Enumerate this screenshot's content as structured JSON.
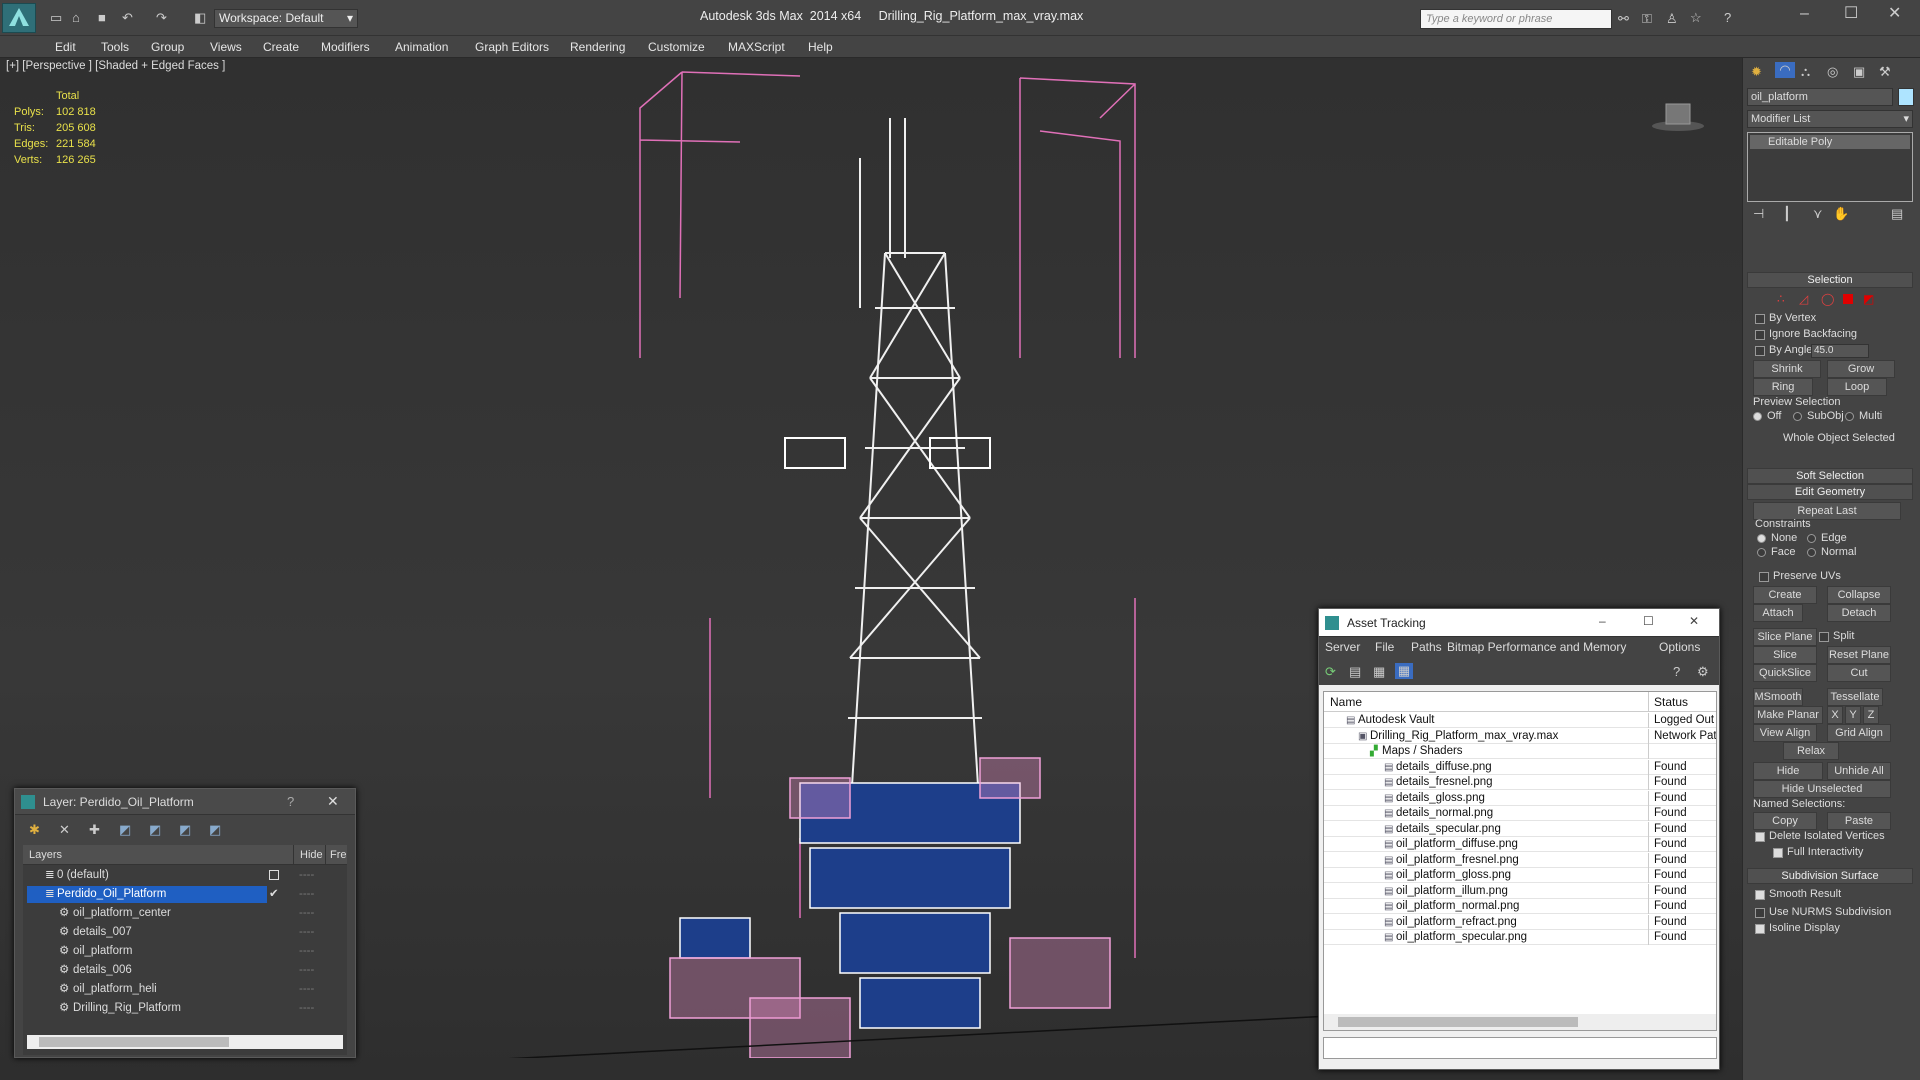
{
  "titlebar": {
    "title": "Autodesk 3ds Max  2014 x64     Drilling_Rig_Platform_max_vray.max",
    "workspace": "Workspace: Default",
    "search_placeholder": "Type a keyword or phrase"
  },
  "menu": [
    "Edit",
    "Tools",
    "Group",
    "Views",
    "Create",
    "Modifiers",
    "Animation",
    "Graph Editors",
    "Rendering",
    "Customize",
    "MAXScript",
    "Help"
  ],
  "viewport": {
    "label": "[+] [Perspective ] [Shaded + Edged Faces ]",
    "stats": {
      "header": "Total",
      "rows": [
        {
          "k": "Polys:",
          "v": "102 818"
        },
        {
          "k": "Tris:",
          "v": "205 608"
        },
        {
          "k": "Edges:",
          "v": "221 584"
        },
        {
          "k": "Verts:",
          "v": "126 265"
        }
      ]
    }
  },
  "command_panel": {
    "object_name": "oil_platform",
    "modifier_list": "Modifier List",
    "stack": [
      "Editable Poly"
    ],
    "selection": {
      "header": "Selection",
      "by_vertex": "By Vertex",
      "ignore_backfacing": "Ignore Backfacing",
      "by_angle": "By Angle:",
      "angle": "45.0",
      "shrink": "Shrink",
      "grow": "Grow",
      "ring": "Ring",
      "loop": "Loop",
      "preview": "Preview Selection",
      "off": "Off",
      "subobj": "SubObj",
      "multi": "Multi",
      "status": "Whole Object Selected"
    },
    "soft_selection": "Soft Selection",
    "edit_geometry": "Edit Geometry",
    "repeat_last": "Repeat Last",
    "constraints": "Constraints",
    "none": "None",
    "edge": "Edge",
    "face": "Face",
    "normal": "Normal",
    "preserve_uvs": "Preserve UVs",
    "create": "Create",
    "collapse": "Collapse",
    "attach": "Attach",
    "detach": "Detach",
    "slice_plane": "Slice Plane",
    "split": "Split",
    "slice": "Slice",
    "reset_plane": "Reset Plane",
    "quickslice": "QuickSlice",
    "cut": "Cut",
    "msmooth": "MSmooth",
    "tessellate": "Tessellate",
    "make_planar": "Make Planar",
    "x": "X",
    "y": "Y",
    "z": "Z",
    "view_align": "View Align",
    "grid_align": "Grid Align",
    "relax": "Relax",
    "hide_selected": "Hide Selected",
    "unhide_all": "Unhide All",
    "hide_unselected": "Hide Unselected",
    "named_selections": "Named Selections:",
    "copy": "Copy",
    "paste": "Paste",
    "delete_isolated": "Delete Isolated Vertices",
    "full_interactivity": "Full Interactivity",
    "subdivision_surface": "Subdivision Surface",
    "smooth_result": "Smooth Result",
    "use_nurms": "Use NURMS Subdivision",
    "isoline_display": "Isoline Display"
  },
  "layer_dialog": {
    "title": "Layer: Perdido_Oil_Platform",
    "help": "?",
    "col_layers": "Layers",
    "col_hide": "Hide",
    "col_freeze": "Fre",
    "rows": [
      "0 (default)",
      "Perdido_Oil_Platform",
      "oil_platform_center",
      "details_007",
      "oil_platform",
      "details_006",
      "oil_platform_heli",
      "Drilling_Rig_Platform"
    ]
  },
  "asset_tracking": {
    "title": "Asset Tracking",
    "menu": [
      "Server",
      "File",
      "Paths",
      "Bitmap Performance and Memory",
      "Options"
    ],
    "col_name": "Name",
    "col_status": "Status",
    "rows": [
      {
        "name": "Autodesk Vault",
        "status": "Logged Out"
      },
      {
        "name": "Drilling_Rig_Platform_max_vray.max",
        "status": "Network Pat"
      },
      {
        "name": "Maps / Shaders",
        "status": ""
      },
      {
        "name": "details_diffuse.png",
        "status": "Found"
      },
      {
        "name": "details_fresnel.png",
        "status": "Found"
      },
      {
        "name": "details_gloss.png",
        "status": "Found"
      },
      {
        "name": "details_normal.png",
        "status": "Found"
      },
      {
        "name": "details_specular.png",
        "status": "Found"
      },
      {
        "name": "oil_platform_diffuse.png",
        "status": "Found"
      },
      {
        "name": "oil_platform_fresnel.png",
        "status": "Found"
      },
      {
        "name": "oil_platform_gloss.png",
        "status": "Found"
      },
      {
        "name": "oil_platform_illum.png",
        "status": "Found"
      },
      {
        "name": "oil_platform_normal.png",
        "status": "Found"
      },
      {
        "name": "oil_platform_refract.png",
        "status": "Found"
      },
      {
        "name": "oil_platform_specular.png",
        "status": "Found"
      }
    ]
  }
}
